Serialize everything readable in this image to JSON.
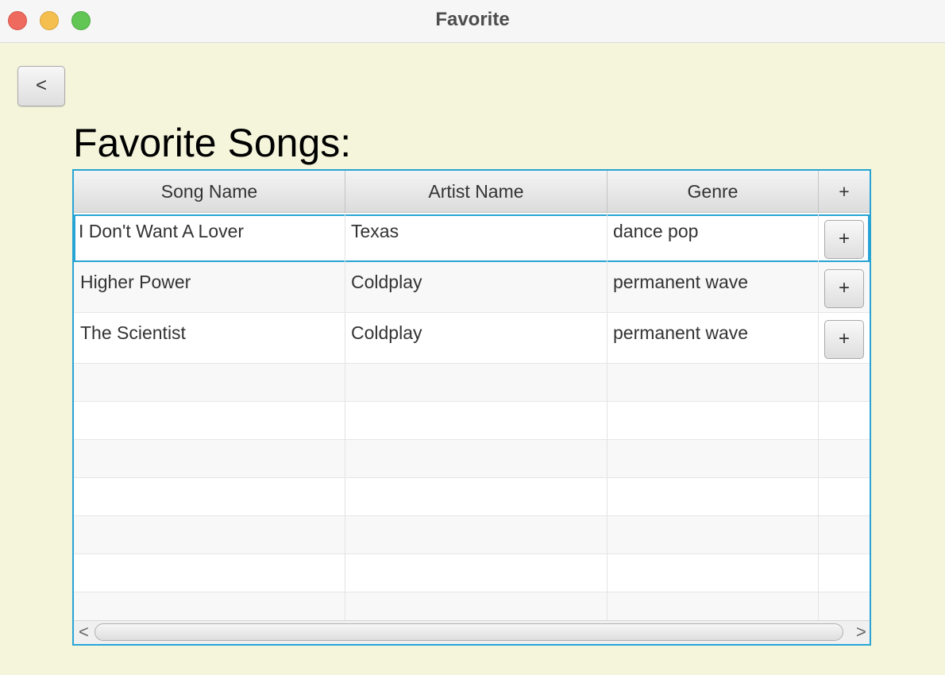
{
  "window": {
    "title": "Favorite"
  },
  "nav": {
    "back_label": "<"
  },
  "page": {
    "heading": "Favorite Songs:"
  },
  "table": {
    "columns": [
      "Song Name",
      "Artist Name",
      "Genre",
      "+"
    ],
    "rows": [
      {
        "song": "I Don't Want A Lover",
        "artist": "Texas",
        "genre": "dance pop",
        "action": "+"
      },
      {
        "song": "Higher Power",
        "artist": "Coldplay",
        "genre": "permanent wave",
        "action": "+"
      },
      {
        "song": "The Scientist",
        "artist": "Coldplay",
        "genre": "permanent wave",
        "action": "+"
      }
    ],
    "selected_row": 0
  },
  "scrollbar": {
    "left_arrow": "<",
    "right_arrow": ">"
  },
  "colors": {
    "background": "#f5f5dc",
    "focus": "#27a4d4"
  }
}
